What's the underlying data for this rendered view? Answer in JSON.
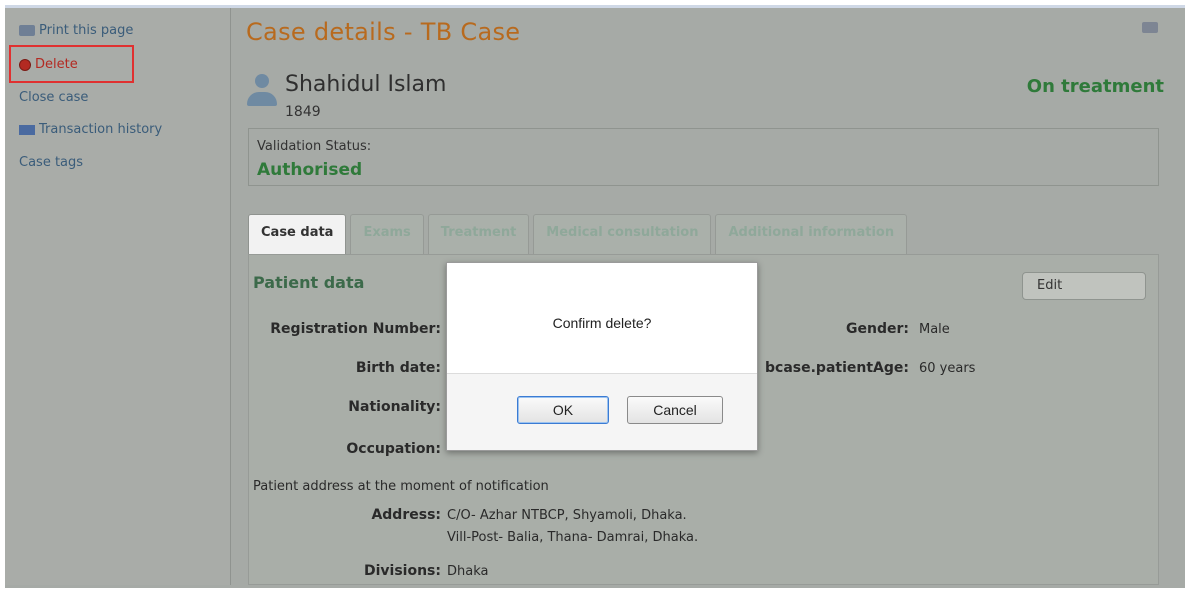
{
  "sidebar": {
    "items": [
      {
        "label": "Print this page",
        "icon": "printer-icon"
      },
      {
        "label": "Delete",
        "icon": "delete-icon"
      },
      {
        "label": "Close case"
      },
      {
        "label": "Transaction history",
        "icon": "history-icon"
      },
      {
        "label": "Case tags"
      }
    ]
  },
  "header": {
    "title": "Case details - TB Case",
    "patient_name": "Shahidul Islam",
    "patient_id": "1849",
    "status": "On treatment"
  },
  "validation": {
    "label": "Validation Status:",
    "value": "Authorised"
  },
  "tabs": [
    {
      "label": "Case data",
      "active": true
    },
    {
      "label": "Exams"
    },
    {
      "label": "Treatment"
    },
    {
      "label": "Medical consultation"
    },
    {
      "label": "Additional information"
    }
  ],
  "patient": {
    "section_title": "Patient data",
    "edit_label": "Edit",
    "fields": {
      "registration_label": "Registration Number:",
      "birth_label": "Birth date:",
      "nationality_label": "Nationality:",
      "occupation_label": "Occupation:",
      "occupation_value": "",
      "gender_label": "Gender:",
      "gender_value": "Male",
      "age_label": "bcase.patientAge:",
      "age_value": "60 years"
    },
    "address_note": "Patient address at the moment of notification",
    "address_label": "Address:",
    "address_line1": "C/O- Azhar NTBCP, Shyamoli, Dhaka.",
    "address_line2": "Vill-Post- Balia, Thana- Damrai, Dhaka.",
    "divisions_label": "Divisions:",
    "divisions_value": "Dhaka"
  },
  "dialog": {
    "message": "Confirm delete?",
    "ok_label": "OK",
    "cancel_label": "Cancel"
  },
  "colors": {
    "title": "#b86a1e",
    "status": "#2f7a3a",
    "link": "#3a5c7a",
    "highlight": "#e03030"
  }
}
